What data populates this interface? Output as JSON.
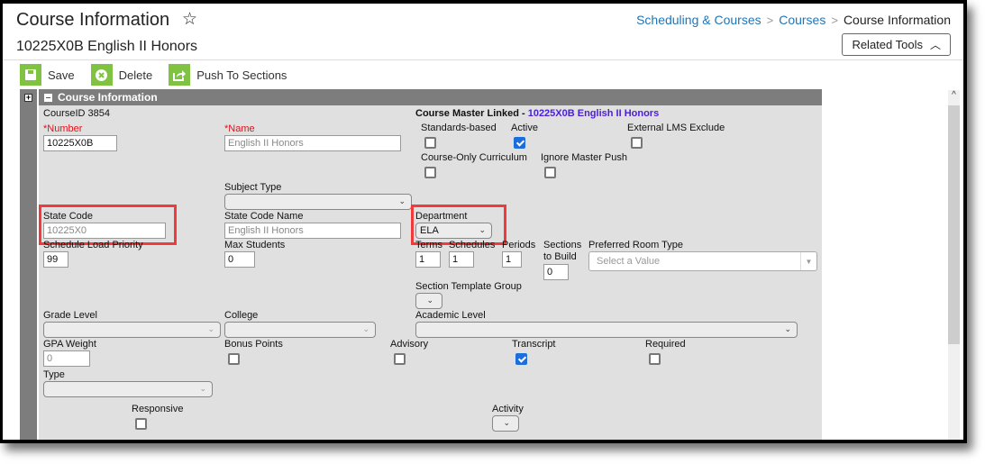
{
  "header": {
    "title": "Course Information",
    "subtitle": "10225X0B English II Honors",
    "star_icon": "star-outline-icon",
    "breadcrumb": [
      "Scheduling & Courses",
      "Courses",
      "Course Information"
    ],
    "breadcrumb_sep": ">",
    "related_tools_label": "Related Tools",
    "related_tools_icon": "^"
  },
  "toolbar": {
    "save_label": "Save",
    "delete_label": "Delete",
    "push_label": "Push To Sections"
  },
  "panel": {
    "title": "Course Information",
    "course_id": "CourseID 3854",
    "master_linked_label": "Course Master Linked - ",
    "master_linked_value": "10225X0B English II Honors"
  },
  "fields": {
    "number": {
      "label": "*Number",
      "value": "10225X0B"
    },
    "name": {
      "label": "*Name",
      "value": "English II Honors"
    },
    "standards_based": {
      "label": "Standards-based",
      "checked": false
    },
    "active": {
      "label": "Active",
      "checked": true
    },
    "external_lms_exclude": {
      "label": "External LMS Exclude",
      "checked": false
    },
    "course_only_curriculum": {
      "label": "Course-Only Curriculum",
      "checked": false
    },
    "ignore_master_push": {
      "label": "Ignore Master Push",
      "checked": false
    },
    "subject_type": {
      "label": "Subject Type",
      "value": ""
    },
    "state_code": {
      "label": "State Code",
      "value": "10225X0"
    },
    "state_code_name": {
      "label": "State Code Name",
      "value": "English II Honors"
    },
    "department": {
      "label": "Department",
      "value": "ELA"
    },
    "schedule_load_priority": {
      "label": "Schedule Load Priority",
      "value": "99"
    },
    "max_students": {
      "label": "Max Students",
      "value": "0"
    },
    "terms": {
      "label": "Terms",
      "value": "1"
    },
    "schedules": {
      "label": "Schedules",
      "value": "1"
    },
    "periods": {
      "label": "Periods",
      "value": "1"
    },
    "sections_to_build": {
      "label_line1": "Sections",
      "label_line2": "to Build",
      "value": "0"
    },
    "preferred_room_type": {
      "label": "Preferred Room Type",
      "placeholder": "Select a Value"
    },
    "section_template_group": {
      "label": "Section Template Group",
      "value": ""
    },
    "grade_level": {
      "label": "Grade Level",
      "value": ""
    },
    "college": {
      "label": "College",
      "value": ""
    },
    "academic_level": {
      "label": "Academic Level",
      "value": ""
    },
    "gpa_weight": {
      "label": "GPA Weight",
      "value": "0"
    },
    "bonus_points": {
      "label": "Bonus Points",
      "checked": false
    },
    "advisory": {
      "label": "Advisory",
      "checked": false
    },
    "transcript": {
      "label": "Transcript",
      "checked": true
    },
    "required": {
      "label": "Required",
      "checked": false
    },
    "type": {
      "label": "Type",
      "value": ""
    },
    "responsive": {
      "label": "Responsive",
      "checked": false
    },
    "activity": {
      "label": "Activity",
      "value": ""
    }
  },
  "colors": {
    "breadcrumb_link": "#1f76b9",
    "toolbar_icon_bg": "#80c241",
    "panel_header_bg": "#7d7d7d",
    "panel_body_bg": "#e0e0e0",
    "required_label": "#e0101a",
    "master_link": "#4b1ed6",
    "checkbox_checked": "#1a6fdd",
    "highlight_box": "#ef3b3b"
  }
}
